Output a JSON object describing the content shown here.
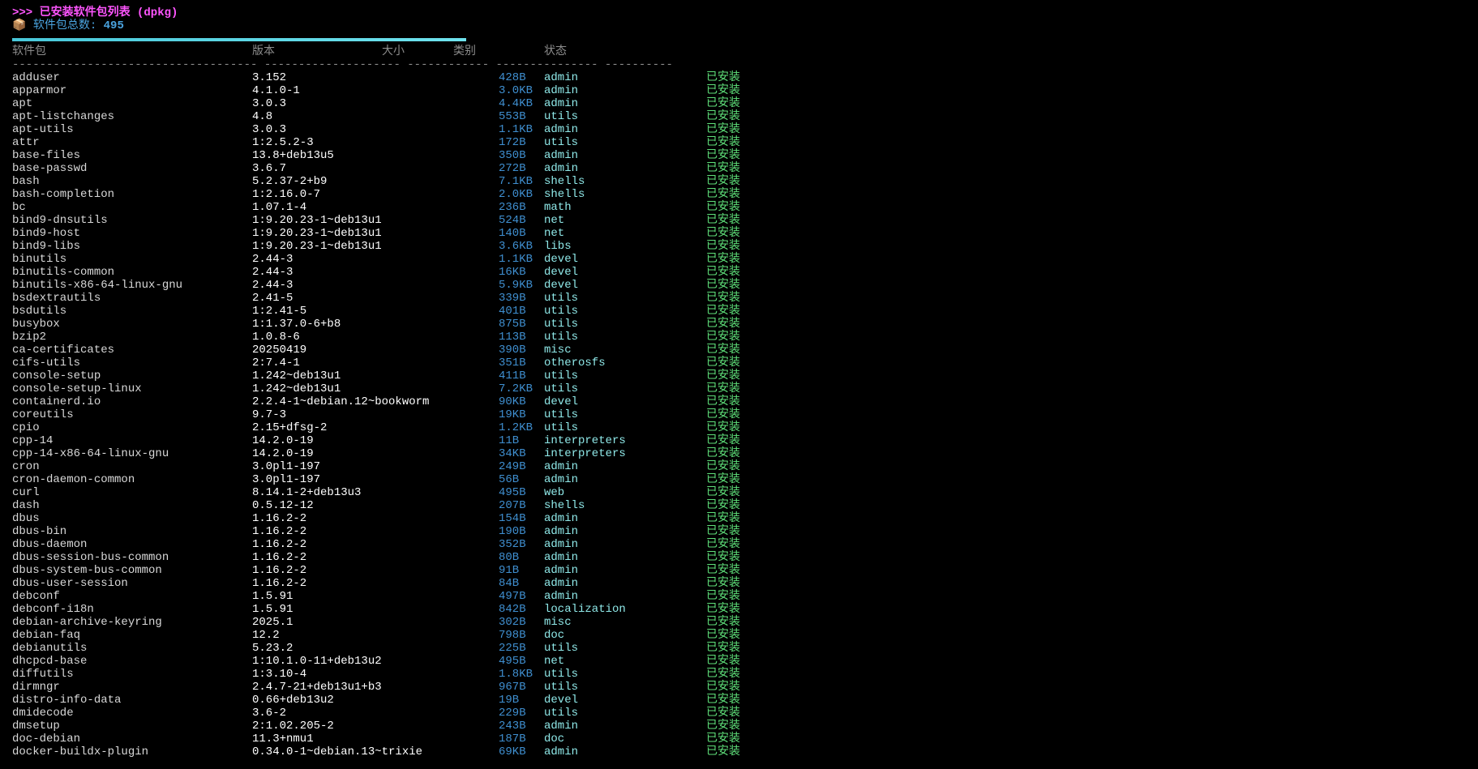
{
  "header": {
    "title": ">>> 已安装软件包列表 (dpkg)",
    "count_icon": "package-icon",
    "count_label": "软件包总数: ",
    "count_value": "495"
  },
  "columns": {
    "name": "软件包",
    "version": "版本",
    "size": "大小",
    "category": "类别",
    "status": "状态"
  },
  "separator": "------------------------------------ -------------------- ------------ --------------- ----------",
  "colors": {
    "title": "#ff55ff",
    "count": "#4aa3df",
    "progress": "#48c7d9",
    "size": "#3f8fd0",
    "category": "#8fe8e8",
    "status": "#5fe07a"
  },
  "packages": [
    {
      "name": "adduser",
      "version": "3.152",
      "size": "428B",
      "category": "admin",
      "status": "已安装"
    },
    {
      "name": "apparmor",
      "version": "4.1.0-1",
      "size": "3.0KB",
      "category": "admin",
      "status": "已安装"
    },
    {
      "name": "apt",
      "version": "3.0.3",
      "size": "4.4KB",
      "category": "admin",
      "status": "已安装"
    },
    {
      "name": "apt-listchanges",
      "version": "4.8",
      "size": "553B",
      "category": "utils",
      "status": "已安装"
    },
    {
      "name": "apt-utils",
      "version": "3.0.3",
      "size": "1.1KB",
      "category": "admin",
      "status": "已安装"
    },
    {
      "name": "attr",
      "version": "1:2.5.2-3",
      "size": "172B",
      "category": "utils",
      "status": "已安装"
    },
    {
      "name": "base-files",
      "version": "13.8+deb13u5",
      "size": "350B",
      "category": "admin",
      "status": "已安装"
    },
    {
      "name": "base-passwd",
      "version": "3.6.7",
      "size": "272B",
      "category": "admin",
      "status": "已安装"
    },
    {
      "name": "bash",
      "version": "5.2.37-2+b9",
      "size": "7.1KB",
      "category": "shells",
      "status": "已安装"
    },
    {
      "name": "bash-completion",
      "version": "1:2.16.0-7",
      "size": "2.0KB",
      "category": "shells",
      "status": "已安装"
    },
    {
      "name": "bc",
      "version": "1.07.1-4",
      "size": "236B",
      "category": "math",
      "status": "已安装"
    },
    {
      "name": "bind9-dnsutils",
      "version": "1:9.20.23-1~deb13u1",
      "size": "524B",
      "category": "net",
      "status": "已安装"
    },
    {
      "name": "bind9-host",
      "version": "1:9.20.23-1~deb13u1",
      "size": "140B",
      "category": "net",
      "status": "已安装"
    },
    {
      "name": "bind9-libs",
      "version": "1:9.20.23-1~deb13u1",
      "size": "3.6KB",
      "category": "libs",
      "status": "已安装"
    },
    {
      "name": "binutils",
      "version": "2.44-3",
      "size": "1.1KB",
      "category": "devel",
      "status": "已安装"
    },
    {
      "name": "binutils-common",
      "version": "2.44-3",
      "size": "16KB",
      "category": "devel",
      "status": "已安装"
    },
    {
      "name": "binutils-x86-64-linux-gnu",
      "version": "2.44-3",
      "size": "5.9KB",
      "category": "devel",
      "status": "已安装"
    },
    {
      "name": "bsdextrautils",
      "version": "2.41-5",
      "size": "339B",
      "category": "utils",
      "status": "已安装"
    },
    {
      "name": "bsdutils",
      "version": "1:2.41-5",
      "size": "401B",
      "category": "utils",
      "status": "已安装"
    },
    {
      "name": "busybox",
      "version": "1:1.37.0-6+b8",
      "size": "875B",
      "category": "utils",
      "status": "已安装"
    },
    {
      "name": "bzip2",
      "version": "1.0.8-6",
      "size": "113B",
      "category": "utils",
      "status": "已安装"
    },
    {
      "name": "ca-certificates",
      "version": "20250419",
      "size": "390B",
      "category": "misc",
      "status": "已安装"
    },
    {
      "name": "cifs-utils",
      "version": "2:7.4-1",
      "size": "351B",
      "category": "otherosfs",
      "status": "已安装"
    },
    {
      "name": "console-setup",
      "version": "1.242~deb13u1",
      "size": "411B",
      "category": "utils",
      "status": "已安装"
    },
    {
      "name": "console-setup-linux",
      "version": "1.242~deb13u1",
      "size": "7.2KB",
      "category": "utils",
      "status": "已安装"
    },
    {
      "name": "containerd.io",
      "version": "2.2.4-1~debian.12~bookworm",
      "size": "90KB",
      "category": "devel",
      "status": "已安装"
    },
    {
      "name": "coreutils",
      "version": "9.7-3",
      "size": "19KB",
      "category": "utils",
      "status": "已安装"
    },
    {
      "name": "cpio",
      "version": "2.15+dfsg-2",
      "size": "1.2KB",
      "category": "utils",
      "status": "已安装"
    },
    {
      "name": "cpp-14",
      "version": "14.2.0-19",
      "size": "11B",
      "category": "interpreters",
      "status": "已安装"
    },
    {
      "name": "cpp-14-x86-64-linux-gnu",
      "version": "14.2.0-19",
      "size": "34KB",
      "category": "interpreters",
      "status": "已安装"
    },
    {
      "name": "cron",
      "version": "3.0pl1-197",
      "size": "249B",
      "category": "admin",
      "status": "已安装"
    },
    {
      "name": "cron-daemon-common",
      "version": "3.0pl1-197",
      "size": "56B",
      "category": "admin",
      "status": "已安装"
    },
    {
      "name": "curl",
      "version": "8.14.1-2+deb13u3",
      "size": "495B",
      "category": "web",
      "status": "已安装"
    },
    {
      "name": "dash",
      "version": "0.5.12-12",
      "size": "207B",
      "category": "shells",
      "status": "已安装"
    },
    {
      "name": "dbus",
      "version": "1.16.2-2",
      "size": "154B",
      "category": "admin",
      "status": "已安装"
    },
    {
      "name": "dbus-bin",
      "version": "1.16.2-2",
      "size": "190B",
      "category": "admin",
      "status": "已安装"
    },
    {
      "name": "dbus-daemon",
      "version": "1.16.2-2",
      "size": "352B",
      "category": "admin",
      "status": "已安装"
    },
    {
      "name": "dbus-session-bus-common",
      "version": "1.16.2-2",
      "size": "80B",
      "category": "admin",
      "status": "已安装"
    },
    {
      "name": "dbus-system-bus-common",
      "version": "1.16.2-2",
      "size": "91B",
      "category": "admin",
      "status": "已安装"
    },
    {
      "name": "dbus-user-session",
      "version": "1.16.2-2",
      "size": "84B",
      "category": "admin",
      "status": "已安装"
    },
    {
      "name": "debconf",
      "version": "1.5.91",
      "size": "497B",
      "category": "admin",
      "status": "已安装"
    },
    {
      "name": "debconf-i18n",
      "version": "1.5.91",
      "size": "842B",
      "category": "localization",
      "status": "已安装"
    },
    {
      "name": "debian-archive-keyring",
      "version": "2025.1",
      "size": "302B",
      "category": "misc",
      "status": "已安装"
    },
    {
      "name": "debian-faq",
      "version": "12.2",
      "size": "798B",
      "category": "doc",
      "status": "已安装"
    },
    {
      "name": "debianutils",
      "version": "5.23.2",
      "size": "225B",
      "category": "utils",
      "status": "已安装"
    },
    {
      "name": "dhcpcd-base",
      "version": "1:10.1.0-11+deb13u2",
      "size": "495B",
      "category": "net",
      "status": "已安装"
    },
    {
      "name": "diffutils",
      "version": "1:3.10-4",
      "size": "1.8KB",
      "category": "utils",
      "status": "已安装"
    },
    {
      "name": "dirmngr",
      "version": "2.4.7-21+deb13u1+b3",
      "size": "967B",
      "category": "utils",
      "status": "已安装"
    },
    {
      "name": "distro-info-data",
      "version": "0.66+deb13u2",
      "size": "19B",
      "category": "devel",
      "status": "已安装"
    },
    {
      "name": "dmidecode",
      "version": "3.6-2",
      "size": "229B",
      "category": "utils",
      "status": "已安装"
    },
    {
      "name": "dmsetup",
      "version": "2:1.02.205-2",
      "size": "243B",
      "category": "admin",
      "status": "已安装"
    },
    {
      "name": "doc-debian",
      "version": "11.3+nmu1",
      "size": "187B",
      "category": "doc",
      "status": "已安装"
    },
    {
      "name": "docker-buildx-plugin",
      "version": "0.34.0-1~debian.13~trixie",
      "size": "69KB",
      "category": "admin",
      "status": "已安装"
    }
  ]
}
